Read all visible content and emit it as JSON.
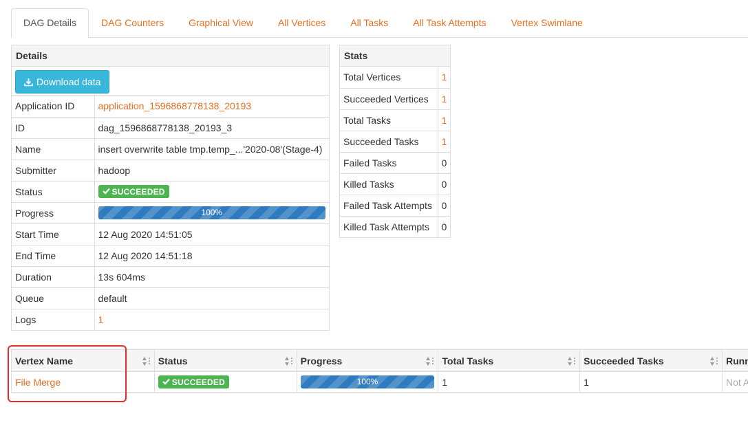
{
  "tabs": [
    {
      "label": "DAG Details",
      "active": true
    },
    {
      "label": "DAG Counters"
    },
    {
      "label": "Graphical View"
    },
    {
      "label": "All Vertices"
    },
    {
      "label": "All Tasks"
    },
    {
      "label": "All Task Attempts"
    },
    {
      "label": "Vertex Swimlane"
    }
  ],
  "details": {
    "title": "Details",
    "download_label": "Download data",
    "download_icon": "download-icon",
    "rows": {
      "application_id": {
        "label": "Application ID",
        "value": "application_1596868778138_20193"
      },
      "id": {
        "label": "ID",
        "value": "dag_1596868778138_20193_3"
      },
      "name": {
        "label": "Name",
        "value": "insert overwrite table tmp.temp_...'2020-08'(Stage-4)"
      },
      "submitter": {
        "label": "Submitter",
        "value": "hadoop"
      },
      "status": {
        "label": "Status",
        "value": "SUCCEEDED"
      },
      "progress": {
        "label": "Progress",
        "value": "100%",
        "fraction": 1.0
      },
      "start_time": {
        "label": "Start Time",
        "value": "12 Aug 2020 14:51:05"
      },
      "end_time": {
        "label": "End Time",
        "value": "12 Aug 2020 14:51:18"
      },
      "duration": {
        "label": "Duration",
        "value": "13s 604ms"
      },
      "queue": {
        "label": "Queue",
        "value": "default"
      },
      "logs": {
        "label": "Logs",
        "value": "1"
      }
    }
  },
  "stats": {
    "title": "Stats",
    "rows": [
      {
        "label": "Total Vertices",
        "value": "1"
      },
      {
        "label": "Succeeded Vertices",
        "value": "1"
      },
      {
        "label": "Total Tasks",
        "value": "1"
      },
      {
        "label": "Succeeded Tasks",
        "value": "1"
      },
      {
        "label": "Failed Tasks",
        "value": "0"
      },
      {
        "label": "Killed Tasks",
        "value": "0"
      },
      {
        "label": "Failed Task Attempts",
        "value": "0"
      },
      {
        "label": "Killed Task Attempts",
        "value": "0"
      }
    ]
  },
  "vertices": {
    "columns": [
      "Vertex Name",
      "Status",
      "Progress",
      "Total Tasks",
      "Succeeded Tasks",
      "Runn"
    ],
    "rows": [
      {
        "name": "File Merge",
        "status": "SUCCEEDED",
        "progress": "100%",
        "progress_fraction": 1.0,
        "total_tasks": "1",
        "succeeded_tasks": "1",
        "running": "Not A"
      }
    ]
  },
  "colors": {
    "accent": "#e57022",
    "success": "#4cb552",
    "progress": "#2f7bbf",
    "info_button": "#38b7db",
    "highlight": "#e32c2c"
  }
}
